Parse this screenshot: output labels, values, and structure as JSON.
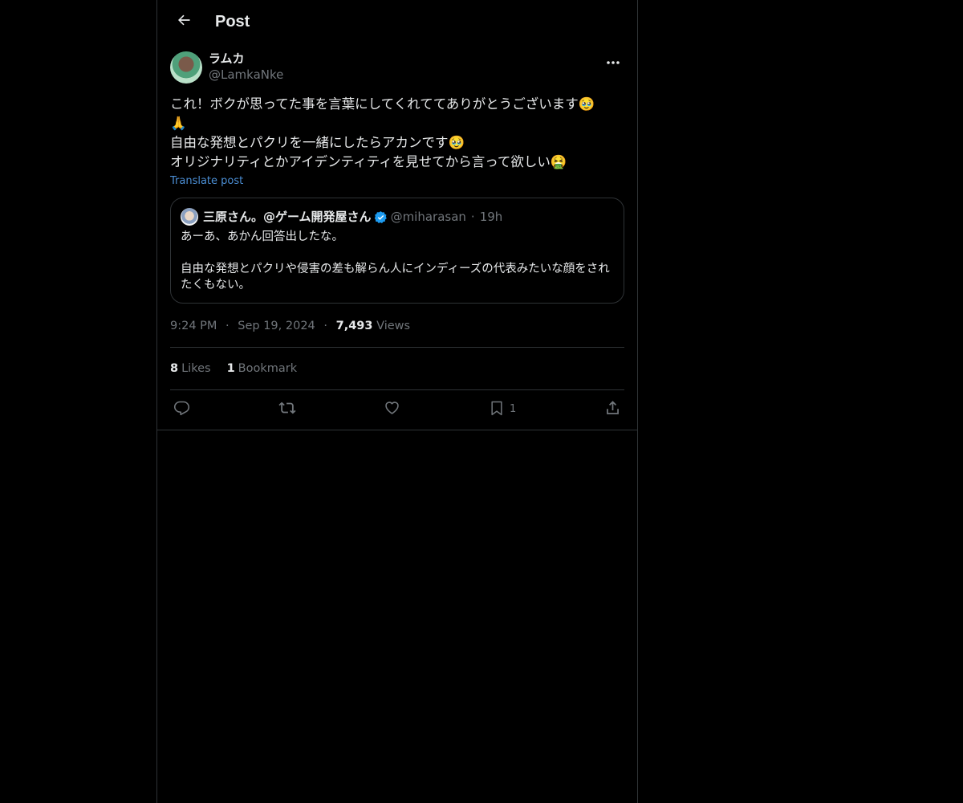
{
  "header": {
    "title": "Post"
  },
  "post": {
    "author": {
      "display_name": "ラムカ",
      "handle": "@LamkaNke"
    },
    "text": "これ！ボクが思ってた事を言葉にしてくれててありがとうございます🥹\n🙏\n自由な発想とパクリを一緒にしたらアカンです🥹\nオリジナリティとかアイデンティティを見せてから言って欲しい🤮",
    "translate_label": "Translate post",
    "quote": {
      "display_name": "三原さん。@ゲーム開発屋さん",
      "handle": "@miharasan",
      "separator": "·",
      "time": "19h",
      "text": "あーあ、あかん回答出したな。\n\n自由な発想とパクリや侵害の差も解らん人にインディーズの代表みたいな顔をされたくもない。"
    },
    "meta": {
      "time": "9:24 PM",
      "date": "Sep 19, 2024",
      "separator": "·",
      "views_count": "7,493",
      "views_label": "Views"
    },
    "stats": {
      "likes_count": "8",
      "likes_label": "Likes",
      "bookmarks_count": "1",
      "bookmarks_label": "Bookmark"
    },
    "actions": {
      "bookmark_count": "1"
    }
  },
  "icons": [
    "back-arrow-icon",
    "more-icon",
    "verified-icon",
    "reply-icon",
    "repost-icon",
    "like-icon",
    "bookmark-icon",
    "share-icon"
  ],
  "colors": {
    "background": "#000000",
    "border": "#2f3336",
    "text": "#e7e9ea",
    "muted": "#71767b",
    "link": "#4b8ed4",
    "verified": "#1d9bf0"
  }
}
